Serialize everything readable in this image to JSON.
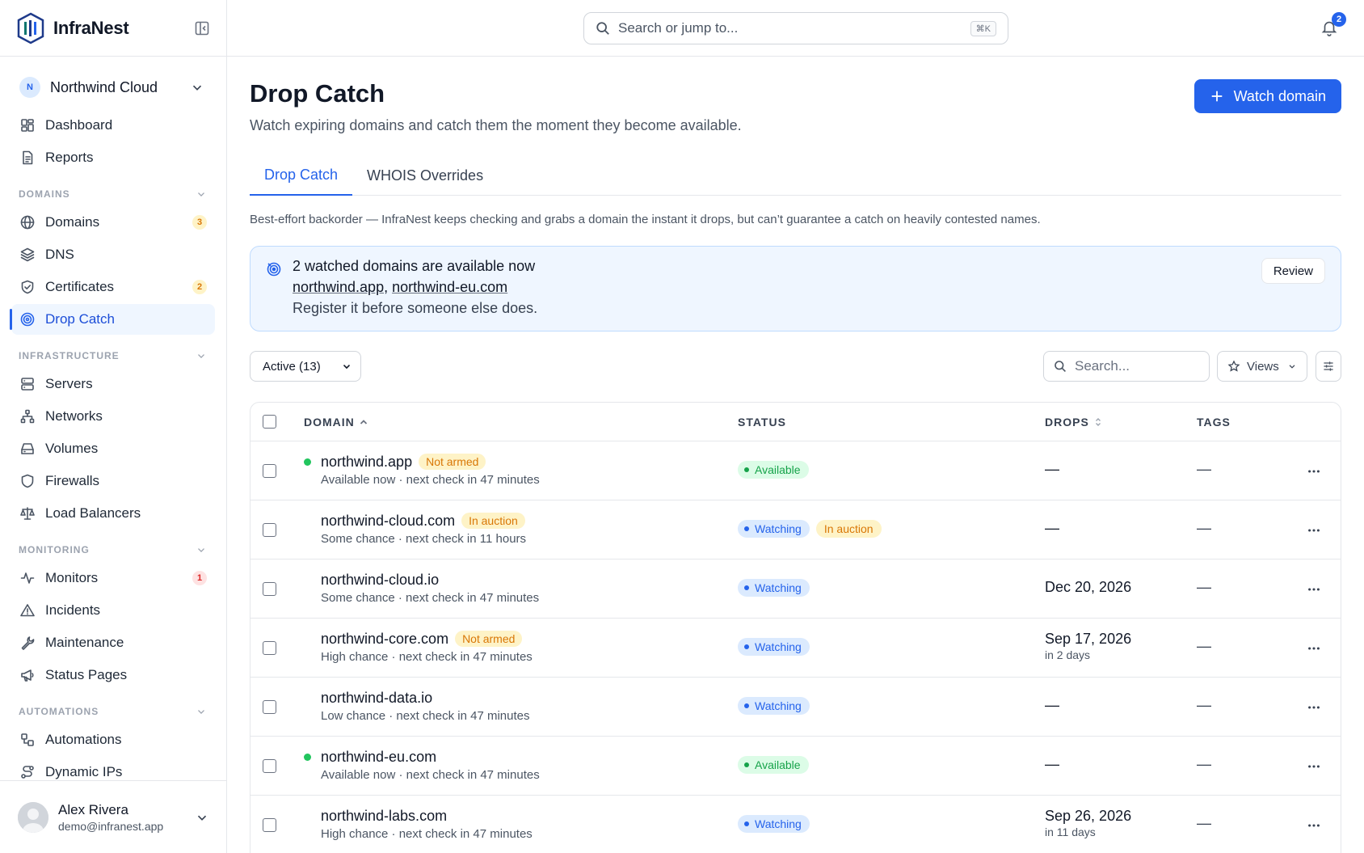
{
  "brand": {
    "name": "InfraNest"
  },
  "org": {
    "initial": "N",
    "name": "Northwind Cloud"
  },
  "nav": {
    "top": [
      {
        "label": "Dashboard",
        "icon": "dashboard-icon"
      },
      {
        "label": "Reports",
        "icon": "reports-icon"
      }
    ],
    "sections": [
      {
        "title": "DOMAINS",
        "items": [
          {
            "label": "Domains",
            "icon": "globe-icon",
            "badge": "3",
            "badge_color": "amber"
          },
          {
            "label": "DNS",
            "icon": "layers-icon"
          },
          {
            "label": "Certificates",
            "icon": "shield-check-icon",
            "badge": "2",
            "badge_color": "amber"
          },
          {
            "label": "Drop Catch",
            "icon": "target-icon",
            "active": true
          }
        ]
      },
      {
        "title": "INFRASTRUCTURE",
        "items": [
          {
            "label": "Servers",
            "icon": "server-icon"
          },
          {
            "label": "Networks",
            "icon": "network-icon"
          },
          {
            "label": "Volumes",
            "icon": "drive-icon"
          },
          {
            "label": "Firewalls",
            "icon": "shield-icon"
          },
          {
            "label": "Load Balancers",
            "icon": "scale-icon"
          }
        ]
      },
      {
        "title": "MONITORING",
        "items": [
          {
            "label": "Monitors",
            "icon": "activity-icon",
            "badge": "1",
            "badge_color": "red"
          },
          {
            "label": "Incidents",
            "icon": "warning-icon"
          },
          {
            "label": "Maintenance",
            "icon": "wrench-icon"
          },
          {
            "label": "Status Pages",
            "icon": "megaphone-icon"
          }
        ]
      },
      {
        "title": "AUTOMATIONS",
        "items": [
          {
            "label": "Automations",
            "icon": "workflow-icon"
          },
          {
            "label": "Dynamic IPs",
            "icon": "route-icon"
          }
        ]
      }
    ]
  },
  "user": {
    "name": "Alex Rivera",
    "email": "demo@infranest.app"
  },
  "topbar": {
    "search_placeholder": "Search or jump to...",
    "shortcut": "⌘K",
    "notifications": "2"
  },
  "page": {
    "title": "Drop Catch",
    "subtitle": "Watch expiring domains and catch them the moment they become available.",
    "primary_action": "Watch domain",
    "tabs": [
      "Drop Catch",
      "WHOIS Overrides"
    ],
    "hint": "Best-effort backorder — InfraNest keeps checking and grabs a domain the instant it drops, but can’t guarantee a catch on heavily contested names."
  },
  "alert": {
    "title": "2 watched domains are available now",
    "links": [
      "northwind.app",
      "northwind-eu.com"
    ],
    "separator": ", ",
    "desc": "Register it before someone else does.",
    "button": "Review"
  },
  "toolbar": {
    "filter": "Active (13)",
    "search_placeholder": "Search...",
    "views": "Views"
  },
  "table": {
    "headers": {
      "domain": "DOMAIN",
      "status": "STATUS",
      "drops": "DROPS",
      "tags": "TAGS"
    },
    "rows": [
      {
        "domain": "northwind.app",
        "live": true,
        "flag": "Not armed",
        "sub": "Available now · next check in 47 minutes",
        "status": [
          {
            "label": "Available",
            "kind": "green"
          }
        ],
        "drops": "—",
        "drops_sub": "",
        "tags": "—"
      },
      {
        "domain": "northwind-cloud.com",
        "live": false,
        "flag": "In auction",
        "sub": "Some chance · next check in 11 hours",
        "status": [
          {
            "label": "Watching",
            "kind": "blue"
          },
          {
            "label": "In auction",
            "kind": "amber"
          }
        ],
        "drops": "—",
        "drops_sub": "",
        "tags": "—"
      },
      {
        "domain": "northwind-cloud.io",
        "live": false,
        "flag": "",
        "sub": "Some chance · next check in 47 minutes",
        "status": [
          {
            "label": "Watching",
            "kind": "blue"
          }
        ],
        "drops": "Dec 20, 2026",
        "drops_sub": "",
        "tags": "—"
      },
      {
        "domain": "northwind-core.com",
        "live": false,
        "flag": "Not armed",
        "sub": "High chance · next check in 47 minutes",
        "status": [
          {
            "label": "Watching",
            "kind": "blue"
          }
        ],
        "drops": "Sep 17, 2026",
        "drops_sub": "in 2 days",
        "tags": "—"
      },
      {
        "domain": "northwind-data.io",
        "live": false,
        "flag": "",
        "sub": "Low chance · next check in 47 minutes",
        "status": [
          {
            "label": "Watching",
            "kind": "blue"
          }
        ],
        "drops": "—",
        "drops_sub": "",
        "tags": "—"
      },
      {
        "domain": "northwind-eu.com",
        "live": true,
        "flag": "",
        "sub": "Available now · next check in 47 minutes",
        "status": [
          {
            "label": "Available",
            "kind": "green"
          }
        ],
        "drops": "—",
        "drops_sub": "",
        "tags": "—"
      },
      {
        "domain": "northwind-labs.com",
        "live": false,
        "flag": "",
        "sub": "High chance · next check in 47 minutes",
        "status": [
          {
            "label": "Watching",
            "kind": "blue"
          }
        ],
        "drops": "Sep 26, 2026",
        "drops_sub": "in 11 days",
        "tags": "—"
      }
    ]
  }
}
